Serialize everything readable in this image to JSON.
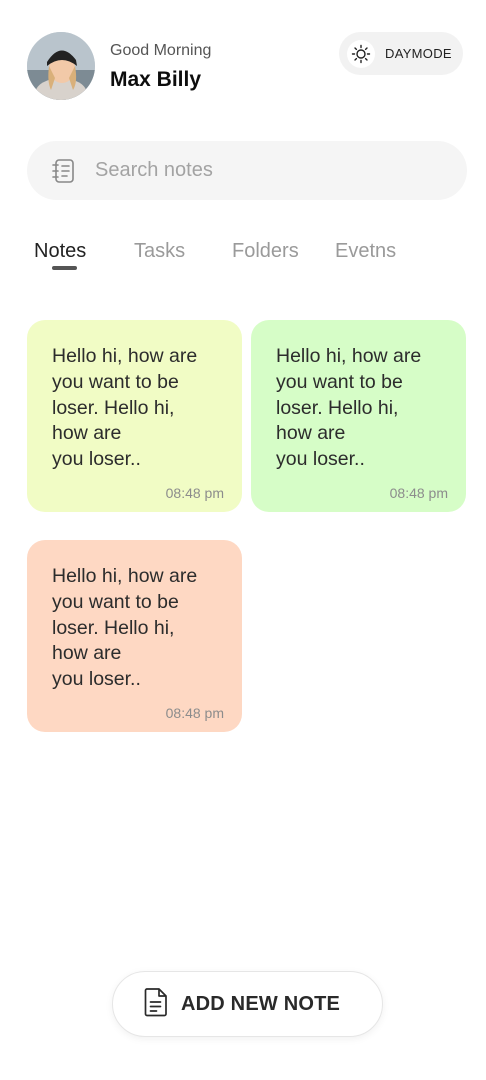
{
  "header": {
    "greeting": "Good Morning",
    "username": "Max Billy",
    "avatar_icon": "user-avatar-photo",
    "theme_toggle": {
      "label": "DAYMODE",
      "icon": "sun-icon"
    }
  },
  "search": {
    "placeholder": "Search notes",
    "value": "",
    "icon": "notebook-icon"
  },
  "tabs": [
    {
      "label": "Notes",
      "active": true
    },
    {
      "label": "Tasks",
      "active": false
    },
    {
      "label": "Folders",
      "active": false
    },
    {
      "label": "Evetns",
      "active": false
    }
  ],
  "notes": [
    {
      "line1": "Hello hi, how are",
      "line2": "you want to be",
      "line3": "loser. Hello hi,",
      "line4": "how are",
      "line5": "you loser..",
      "time": "08:48 pm",
      "color": "#f1fcc5"
    },
    {
      "line1": "Hello hi, how are",
      "line2": "you want to be",
      "line3": "loser. Hello hi,",
      "line4": "how are",
      "line5": "you loser..",
      "time": "08:48 pm",
      "color": "#d6fdc7"
    },
    {
      "line1": "Hello hi, how are",
      "line2": "you want to be",
      "line3": "loser. Hello hi,",
      "line4": "how are",
      "line5": "you loser..",
      "time": "08:48 pm",
      "color": "#fed8c3"
    }
  ],
  "add_button": {
    "label": "ADD NEW NOTE",
    "icon": "document-icon"
  }
}
